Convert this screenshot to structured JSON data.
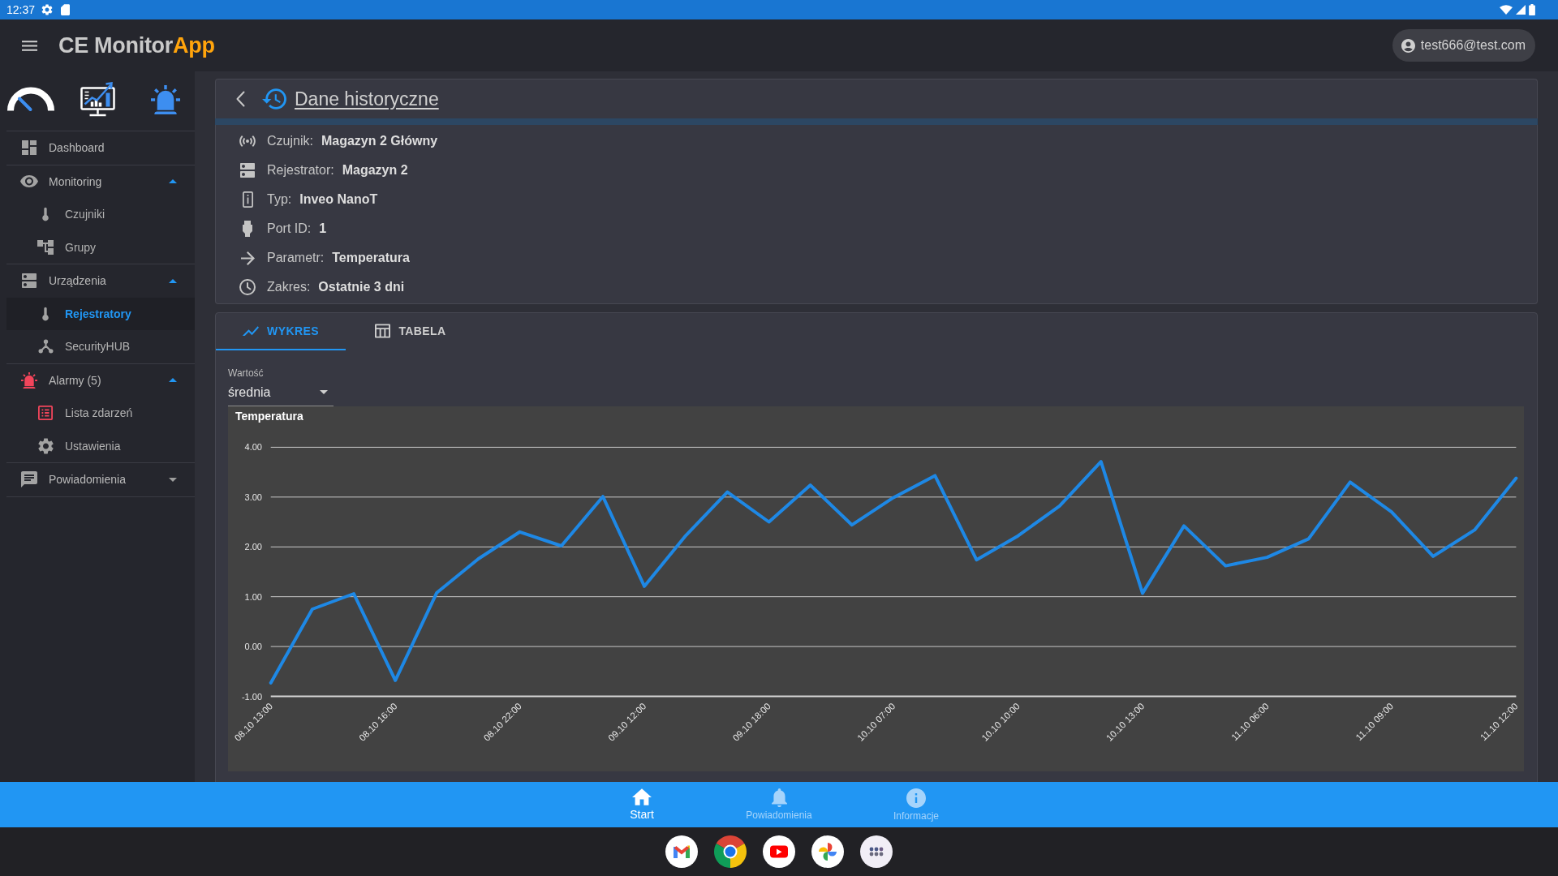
{
  "status_bar": {
    "time": "12:37"
  },
  "app_bar": {
    "title": "CE Monitor",
    "title_accent": "App",
    "user": "test666@test.com"
  },
  "sidebar": {
    "items": [
      {
        "kind": "link",
        "label": "Dashboard",
        "selected": false
      },
      {
        "kind": "group",
        "label": "Monitoring",
        "selected": false,
        "expanded": true,
        "children": [
          {
            "label": "Czujniki",
            "selected": false
          },
          {
            "label": "Grupy",
            "selected": false
          }
        ]
      },
      {
        "kind": "group",
        "label": "Urządzenia",
        "selected": false,
        "expanded": true,
        "children": [
          {
            "label": "Rejestratory",
            "selected": true
          },
          {
            "label": "SecurityHUB",
            "selected": false
          }
        ]
      },
      {
        "kind": "group",
        "label": "Alarmy (5)",
        "selected": false,
        "expanded": true,
        "children": [
          {
            "label": "Lista zdarzeń",
            "selected": false
          },
          {
            "label": "Ustawienia",
            "selected": false
          }
        ]
      },
      {
        "kind": "group",
        "label": "Powiadomienia",
        "selected": false,
        "expanded": false
      }
    ]
  },
  "page_header": {
    "title": "Dane historyczne"
  },
  "details": [
    {
      "label": "Czujnik:",
      "value": "Magazyn 2 Główny"
    },
    {
      "label": "Rejestrator:",
      "value": "Magazyn 2"
    },
    {
      "label": "Typ:",
      "value": "Inveo NanoT"
    },
    {
      "label": "Port ID:",
      "value": "1"
    },
    {
      "label": "Parametr:",
      "value": "Temperatura"
    },
    {
      "label": "Zakres:",
      "value": "Ostatnie 3 dni"
    }
  ],
  "tabs": [
    {
      "label": "WYKRES",
      "selected": true
    },
    {
      "label": "TABELA",
      "selected": false
    }
  ],
  "value_select": {
    "label": "Wartość",
    "value": "średnia"
  },
  "chart": {
    "chart_data": {
      "type": "line",
      "title": "Temperatura",
      "categories": [
        "08.10 13:00",
        null,
        null,
        "08.10 16:00",
        null,
        null,
        "08.10 22:00",
        null,
        null,
        "09.10 12:00",
        null,
        null,
        "09.10 18:00",
        null,
        null,
        "10.10 07:00",
        null,
        null,
        "10.10 10:00",
        null,
        null,
        "10.10 13:00",
        null,
        null,
        "11.10 06:00",
        null,
        null,
        "11.10 09:00",
        null,
        null,
        "11.10 12:00"
      ],
      "series": [
        {
          "color": "#1e88e5",
          "values": [
            -0.73,
            0.75,
            1.06,
            -0.68,
            1.08,
            1.76,
            2.3,
            2.02,
            3.01,
            1.21,
            2.23,
            3.1,
            2.5,
            3.24,
            2.44,
            2.99,
            3.43,
            1.74,
            2.22,
            2.82,
            3.71,
            1.07,
            2.42,
            1.62,
            1.79,
            2.16,
            3.3,
            2.7,
            1.81,
            2.34,
            3.38
          ]
        }
      ],
      "ylim": [
        -1,
        4
      ],
      "yticks": [
        {
          "value": -1,
          "label": "-1.00"
        },
        {
          "value": 0,
          "label": "0.00"
        },
        {
          "value": 1,
          "label": "1.00"
        },
        {
          "value": 2,
          "label": "2.00"
        },
        {
          "value": 3,
          "label": "3.00"
        },
        {
          "value": 4,
          "label": "4.00"
        }
      ],
      "grid": true
    }
  },
  "bottom_nav": [
    {
      "label": "Start",
      "selected": true
    },
    {
      "label": "Powiadomienia",
      "selected": false
    },
    {
      "label": "Informacje",
      "selected": false
    }
  ]
}
